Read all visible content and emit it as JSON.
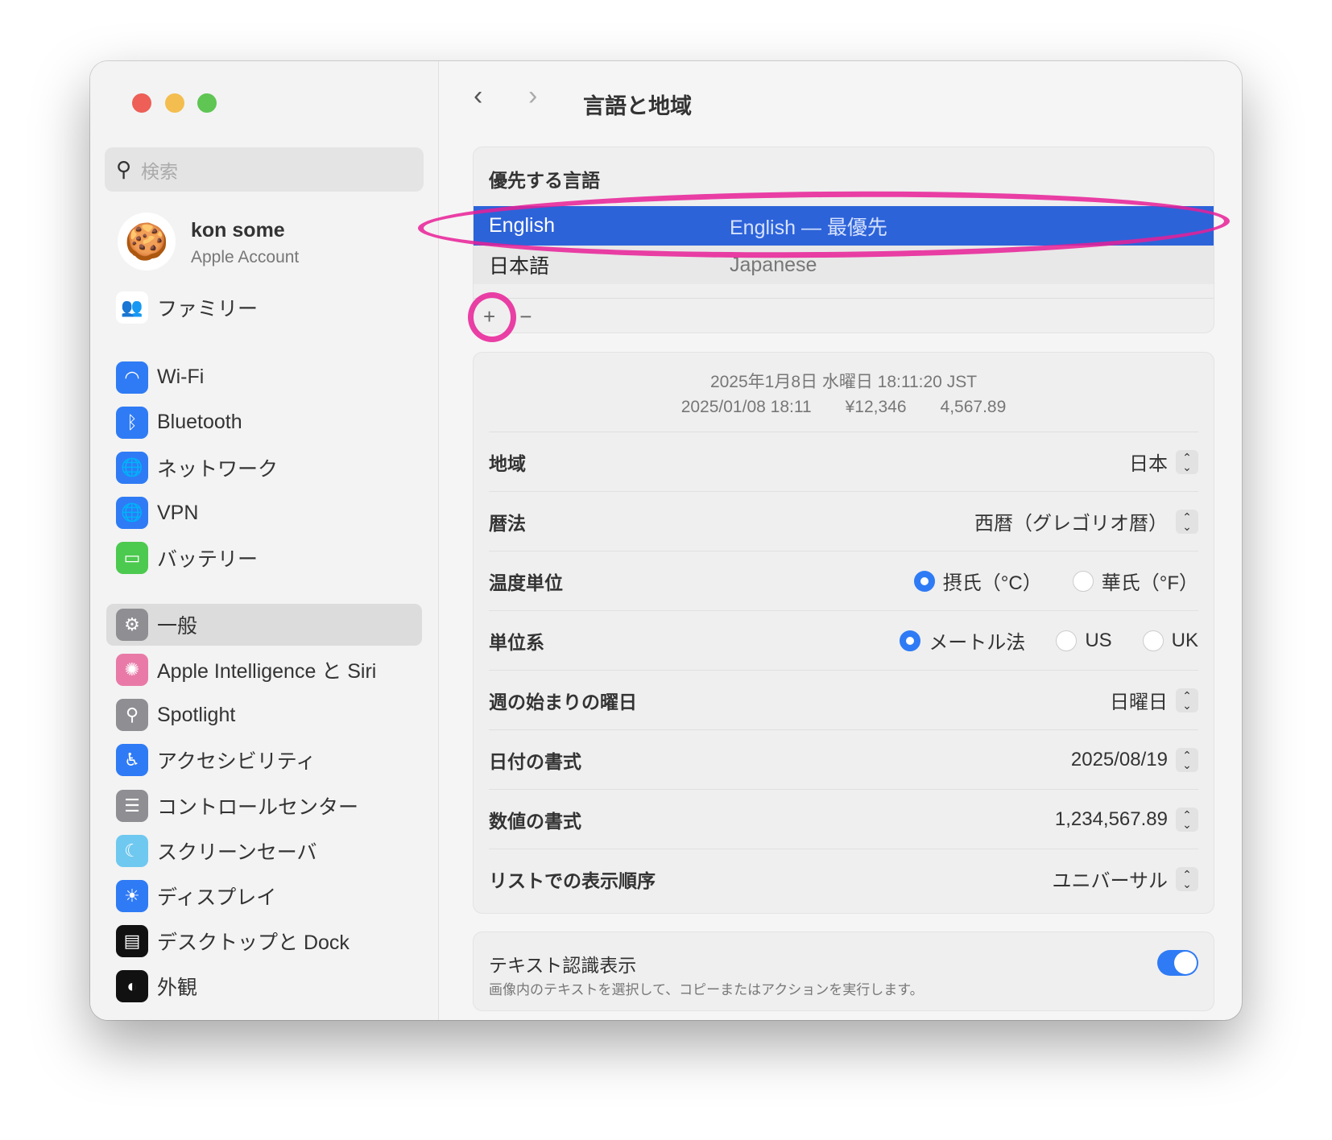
{
  "sidebar": {
    "search_placeholder": "検索",
    "profile": {
      "name": "kon some",
      "subtitle": "Apple Account"
    },
    "family": "ファミリー",
    "items": [
      {
        "label": "Wi-Fi",
        "icon": "wifi-icon",
        "color": "#2f7bf5"
      },
      {
        "label": "Bluetooth",
        "icon": "bluetooth-icon",
        "color": "#2f7bf5"
      },
      {
        "label": "ネットワーク",
        "icon": "globe-icon",
        "color": "#2f7bf5"
      },
      {
        "label": "VPN",
        "icon": "vpn-globe-icon",
        "color": "#2f7bf5"
      },
      {
        "label": "バッテリー",
        "icon": "battery-icon",
        "color": "#4cc94f"
      },
      {
        "label": "一般",
        "icon": "gear-icon",
        "color": "#8e8e93",
        "selected": true
      },
      {
        "label": "Apple Intelligence と Siri",
        "icon": "siri-icon",
        "color": "#e97aa8"
      },
      {
        "label": "Spotlight",
        "icon": "magnifier-icon",
        "color": "#8e8e93"
      },
      {
        "label": "アクセシビリティ",
        "icon": "accessibility-icon",
        "color": "#2f7bf5"
      },
      {
        "label": "コントロールセンター",
        "icon": "toggles-icon",
        "color": "#8e8e93"
      },
      {
        "label": "スクリーンセーバ",
        "icon": "screensaver-icon",
        "color": "#6fc8f0"
      },
      {
        "label": "ディスプレイ",
        "icon": "sun-icon",
        "color": "#2f7bf5"
      },
      {
        "label": "デスクトップと Dock",
        "icon": "dock-icon",
        "color": "#111111"
      },
      {
        "label": "外観",
        "icon": "appearance-icon",
        "color": "#111111"
      }
    ]
  },
  "header": {
    "title": "言語と地域"
  },
  "languages": {
    "heading": "優先する言語",
    "rows": [
      {
        "name": "English",
        "detail": "English — 最優先",
        "selected": true
      },
      {
        "name": "日本語",
        "detail": "Japanese"
      }
    ],
    "add": "+",
    "remove": "−"
  },
  "preview": {
    "line1": "2025年1月8日 水曜日 18:11:20 JST",
    "line2": "2025/01/08 18:11　　¥12,346　　4,567.89"
  },
  "settings": {
    "region": {
      "label": "地域",
      "value": "日本"
    },
    "calendar": {
      "label": "暦法",
      "value": "西暦（グレゴリオ暦）"
    },
    "temperature": {
      "label": "温度単位",
      "options": [
        "摂氏（°C）",
        "華氏（°F）"
      ],
      "selected": 0
    },
    "measurement": {
      "label": "単位系",
      "options": [
        "メートル法",
        "US",
        "UK"
      ],
      "selected": 0
    },
    "first_day": {
      "label": "週の始まりの曜日",
      "value": "日曜日"
    },
    "date_format": {
      "label": "日付の書式",
      "value": "2025/08/19"
    },
    "number_format": {
      "label": "数値の書式",
      "value": "1,234,567.89"
    },
    "list_sort": {
      "label": "リストでの表示順序",
      "value": "ユニバーサル"
    }
  },
  "live_text": {
    "title": "テキスト認識表示",
    "description": "画像内のテキストを選択して、コピーまたはアクションを実行します。",
    "enabled": true
  },
  "colors": {
    "accent": "#2f7bf5",
    "selection": "#2d63d9",
    "annotation": "#e81e96"
  }
}
